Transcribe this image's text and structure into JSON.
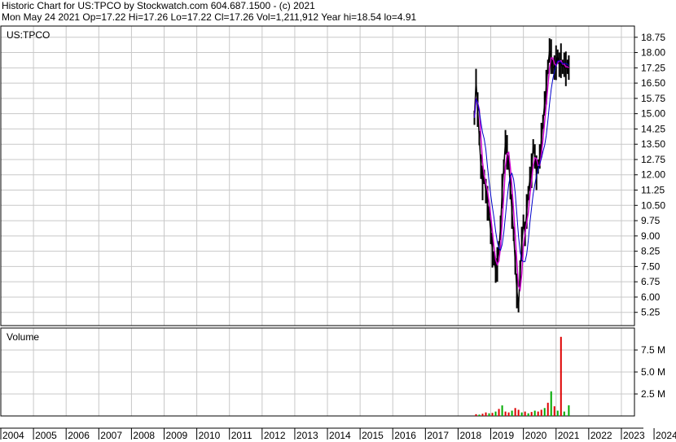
{
  "header": {
    "line1": "Historic Chart for US:TPCO by Stockwatch.com 604.687.1500 - (c) 2021",
    "line2": "Mon May 24 2021   Op=17.22   Hi=17.26   Lo=17.22   Cl=17.26   Vol=1,211,912   Year hi=18.54   lo=4.91"
  },
  "colors": {
    "grid": "#c8c8c8",
    "price": "#000000",
    "ma_short": "#cc00cc",
    "ma_long": "#0000cc",
    "vol_up": "#00aa00",
    "vol_down": "#dd0000"
  },
  "chart_data": [
    {
      "type": "line",
      "title": "US:TPCO",
      "y_ticks": [
        "18.75",
        "18.00",
        "17.25",
        "16.50",
        "15.75",
        "15.00",
        "14.25",
        "13.50",
        "12.75",
        "12.00",
        "11.25",
        "10.50",
        "9.75",
        "9.00",
        "8.25",
        "7.50",
        "6.75",
        "6.00",
        "5.25"
      ],
      "ylim": [
        4.6,
        19.3
      ],
      "x_ticks": [
        "2004",
        "2005",
        "2006",
        "2007",
        "2008",
        "2009",
        "2010",
        "2011",
        "2012",
        "2013",
        "2014",
        "2015",
        "2016",
        "2017",
        "2018",
        "2019",
        "2020",
        "2021",
        "2022",
        "2023",
        "2024"
      ],
      "series": [
        {
          "x": [
            2018.5,
            2018.55,
            2018.6,
            2018.65,
            2018.7,
            2018.75,
            2018.8,
            2018.85,
            2018.9,
            2018.95,
            2019.0,
            2019.05,
            2019.1,
            2019.15,
            2019.2,
            2019.25,
            2019.3,
            2019.35,
            2019.4,
            2019.45,
            2019.5,
            2019.55,
            2019.6,
            2019.65,
            2019.7,
            2019.75,
            2019.8,
            2019.85,
            2019.9,
            2019.95,
            2020.0,
            2020.05,
            2020.1,
            2020.15,
            2020.2,
            2020.25,
            2020.3,
            2020.35,
            2020.4,
            2020.45,
            2020.5,
            2020.55,
            2020.6,
            2020.65,
            2020.7,
            2020.75,
            2020.8,
            2020.85,
            2020.9,
            2020.95,
            2021.0,
            2021.05,
            2021.1,
            2021.15,
            2021.2,
            2021.25,
            2021.3,
            2021.35,
            2021.39
          ],
          "values": [
            14.8,
            16.6,
            15.2,
            13.8,
            12.4,
            11.6,
            11.9,
            11.2,
            10.6,
            10.1,
            9.2,
            8.3,
            7.9,
            7.3,
            7.6,
            8.4,
            9.4,
            11.2,
            12.4,
            13.6,
            13.1,
            12.6,
            11.4,
            10.2,
            9.1,
            7.7,
            6.3,
            5.6,
            7.2,
            8.6,
            9.7,
            9.1,
            10.2,
            11.1,
            11.8,
            12.2,
            13.4,
            12.9,
            12.1,
            12.4,
            12.9,
            13.7,
            14.6,
            15.5,
            16.3,
            17.3,
            18.1,
            17.8,
            17.3,
            17.26,
            17.5,
            17.8,
            17.4,
            17.6,
            17.3,
            17.4,
            17.2,
            17.3,
            17.26
          ]
        }
      ]
    },
    {
      "type": "bar",
      "title": "Volume",
      "y_ticks": [
        "7.5 M",
        "5.0 M",
        "2.5 M"
      ],
      "ylim": [
        0,
        10000000
      ],
      "x": [
        2018.55,
        2018.65,
        2018.75,
        2018.85,
        2018.95,
        2019.05,
        2019.15,
        2019.25,
        2019.35,
        2019.45,
        2019.55,
        2019.65,
        2019.75,
        2019.85,
        2019.95,
        2020.05,
        2020.15,
        2020.25,
        2020.35,
        2020.45,
        2020.55,
        2020.65,
        2020.75,
        2020.85,
        2020.95,
        2021.05,
        2021.15,
        2021.25,
        2021.39
      ],
      "values": [
        200000,
        150000,
        250000,
        400000,
        300000,
        350000,
        500000,
        800000,
        1200000,
        500000,
        400000,
        600000,
        900000,
        700000,
        400000,
        500000,
        300000,
        450000,
        600000,
        500000,
        700000,
        900000,
        1500000,
        2800000,
        1100000,
        600000,
        9000000,
        500000,
        1211912
      ],
      "up": [
        false,
        true,
        false,
        false,
        true,
        false,
        true,
        false,
        true,
        false,
        false,
        true,
        false,
        false,
        true,
        false,
        true,
        false,
        true,
        false,
        false,
        true,
        false,
        true,
        false,
        true,
        false,
        true,
        true
      ]
    }
  ]
}
